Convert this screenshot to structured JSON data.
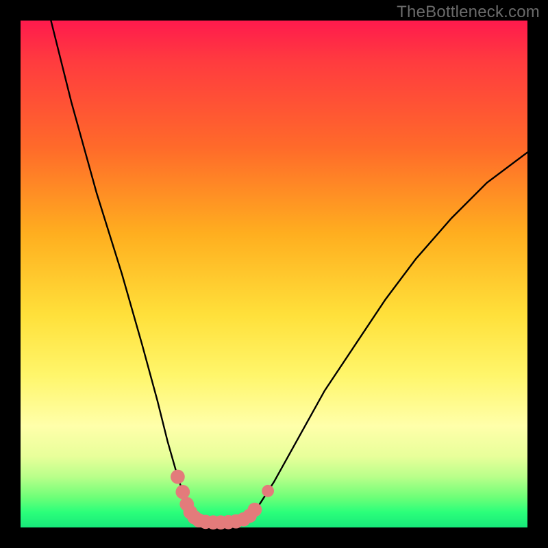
{
  "watermark": {
    "text": "TheBottleneck.com"
  },
  "colors": {
    "curve_stroke": "#000000",
    "marker_fill": "#e37b7b",
    "marker_stroke": "#d86f6f",
    "gradient_top": "#ff1a4d",
    "gradient_bottom": "#17e87a",
    "frame": "#000000"
  },
  "chart_data": {
    "type": "line",
    "title": "",
    "xlabel": "",
    "ylabel": "",
    "xlim": [
      0,
      100
    ],
    "ylim": [
      0,
      100
    ],
    "grid": false,
    "legend": false,
    "series": [
      {
        "name": "bottleneck-curve",
        "x": [
          6,
          10,
          15,
          20,
          24,
          27,
          29,
          31,
          32.5,
          34,
          36,
          40,
          44,
          46,
          50,
          55,
          60,
          66,
          72,
          78,
          85,
          92,
          100
        ],
        "y": [
          100,
          84,
          66,
          50,
          36,
          25,
          17,
          10,
          5.5,
          2.5,
          1.2,
          1.0,
          1.3,
          2.8,
          9,
          18,
          27,
          36,
          45,
          53,
          61,
          68,
          74
        ]
      }
    ],
    "markers": [
      {
        "x": 31.0,
        "y": 10.0,
        "r": 1.4
      },
      {
        "x": 32.0,
        "y": 7.0,
        "r": 1.4
      },
      {
        "x": 32.8,
        "y": 4.6,
        "r": 1.4
      },
      {
        "x": 33.5,
        "y": 3.0,
        "r": 1.4
      },
      {
        "x": 34.3,
        "y": 2.0,
        "r": 1.4
      },
      {
        "x": 35.2,
        "y": 1.4,
        "r": 1.4
      },
      {
        "x": 36.5,
        "y": 1.1,
        "r": 1.4
      },
      {
        "x": 38.0,
        "y": 1.0,
        "r": 1.4
      },
      {
        "x": 39.5,
        "y": 1.0,
        "r": 1.4
      },
      {
        "x": 41.0,
        "y": 1.05,
        "r": 1.4
      },
      {
        "x": 42.5,
        "y": 1.2,
        "r": 1.4
      },
      {
        "x": 44.0,
        "y": 1.6,
        "r": 1.4
      },
      {
        "x": 45.2,
        "y": 2.3,
        "r": 1.4
      },
      {
        "x": 46.2,
        "y": 3.5,
        "r": 1.4
      },
      {
        "x": 48.8,
        "y": 7.2,
        "r": 1.2
      }
    ]
  }
}
